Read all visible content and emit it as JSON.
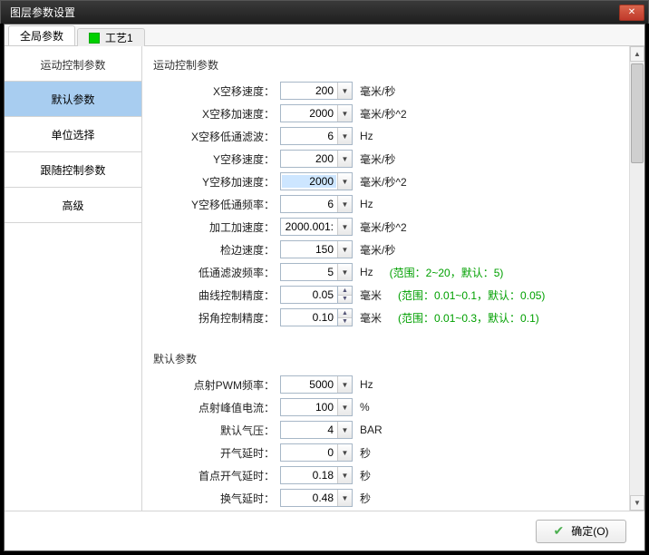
{
  "window": {
    "title": "图层参数设置"
  },
  "tabs": {
    "global": "全局参数",
    "process1": "工艺1"
  },
  "sidebar": {
    "title": "运动控制参数",
    "items": [
      {
        "label": "默认参数",
        "selected": true
      },
      {
        "label": "单位选择",
        "selected": false
      },
      {
        "label": "跟随控制参数",
        "selected": false
      },
      {
        "label": "高级",
        "selected": false
      }
    ]
  },
  "sections": {
    "motion": {
      "title": "运动控制参数",
      "rows": [
        {
          "label": "X空移速度：",
          "value": "200",
          "unit": "毫米/秒",
          "kind": "combo"
        },
        {
          "label": "X空移加速度：",
          "value": "2000",
          "unit": "毫米/秒^2",
          "kind": "combo"
        },
        {
          "label": "X空移低通滤波：",
          "value": "6",
          "unit": "Hz",
          "kind": "combo"
        },
        {
          "label": "Y空移速度：",
          "value": "200",
          "unit": "毫米/秒",
          "kind": "combo"
        },
        {
          "label": "Y空移加速度：",
          "value": "2000",
          "unit": "毫米/秒^2",
          "kind": "combo",
          "hl": true
        },
        {
          "label": "Y空移低通频率：",
          "value": "6",
          "unit": "Hz",
          "kind": "combo"
        },
        {
          "label": "加工加速度：",
          "value": "2000.001:",
          "unit": "毫米/秒^2",
          "kind": "combo"
        },
        {
          "label": "检边速度：",
          "value": "150",
          "unit": "毫米/秒",
          "kind": "combo"
        },
        {
          "label": "低通滤波频率：",
          "value": "5",
          "unit": "Hz",
          "kind": "combo",
          "hint": "(范围：2~20，默认：5)"
        },
        {
          "label": "曲线控制精度：",
          "value": "0.05",
          "unit": "毫米",
          "kind": "spin",
          "hint": "(范围：0.01~0.1，默认：0.05)"
        },
        {
          "label": "拐角控制精度：",
          "value": "0.10",
          "unit": "毫米",
          "kind": "spin",
          "hint": "(范围：0.01~0.3，默认：0.1)"
        }
      ]
    },
    "defaults": {
      "title": "默认参数",
      "rows": [
        {
          "label": "点射PWM频率：",
          "value": "5000",
          "unit": "Hz",
          "kind": "combo"
        },
        {
          "label": "点射峰值电流：",
          "value": "100",
          "unit": "%",
          "kind": "combo"
        },
        {
          "label": "默认气压：",
          "value": "4",
          "unit": "BAR",
          "kind": "combo"
        },
        {
          "label": "开气延时：",
          "value": "0",
          "unit": "秒",
          "kind": "combo"
        },
        {
          "label": "首点开气延时：",
          "value": "0.18",
          "unit": "秒",
          "kind": "combo"
        },
        {
          "label": "换气延时：",
          "value": "0.48",
          "unit": "秒",
          "kind": "combo"
        }
      ]
    }
  },
  "footer": {
    "ok": "确定(O)"
  }
}
